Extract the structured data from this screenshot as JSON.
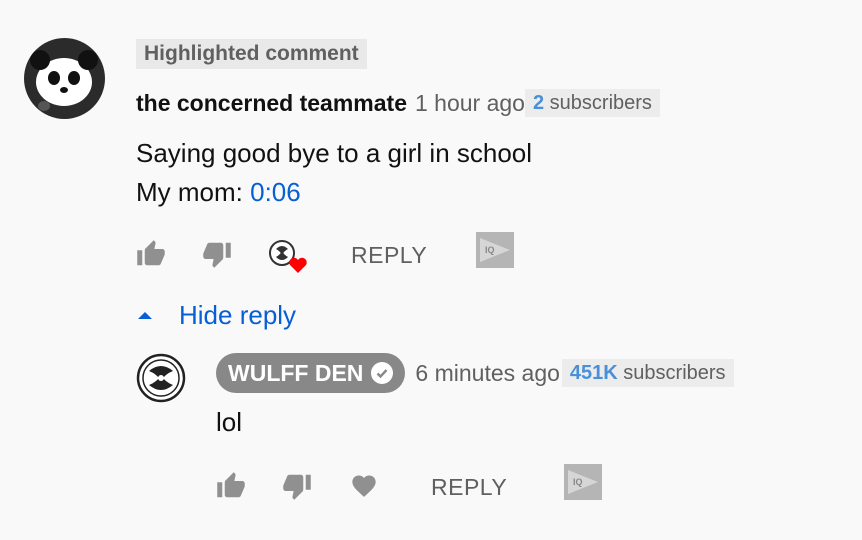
{
  "comment": {
    "badge": "Highlighted comment",
    "author": "the concerned teammate",
    "time": "1 hour ago",
    "subscribers_count": "2",
    "subscribers_label": "subscribers",
    "text_line1": "Saying good bye to a girl in school",
    "text_line2_prefix": "My mom: ",
    "text_line2_timestamp": "0:06",
    "reply_label": "REPLY"
  },
  "hide_replies_label": "Hide reply",
  "reply": {
    "author": "WULFF DEN",
    "time": "6 minutes ago",
    "subscribers_count": "451K",
    "subscribers_label": "subscribers",
    "text": "lol",
    "reply_label": "REPLY"
  },
  "colors": {
    "link_blue": "#065fd4",
    "subs_count_blue": "#4a90d9",
    "icon_gray": "#606060",
    "heart_red": "#ff0000",
    "pill_gray": "#888888",
    "background": "#f9f9f9"
  },
  "icons": {
    "like": "thumbs-up-icon",
    "dislike": "thumbs-down-icon",
    "creator_heart": "creator-heart-icon",
    "heart": "heart-icon",
    "promo": "play-promo-icon",
    "caret": "caret-up-icon",
    "verified": "verified-check-icon"
  }
}
